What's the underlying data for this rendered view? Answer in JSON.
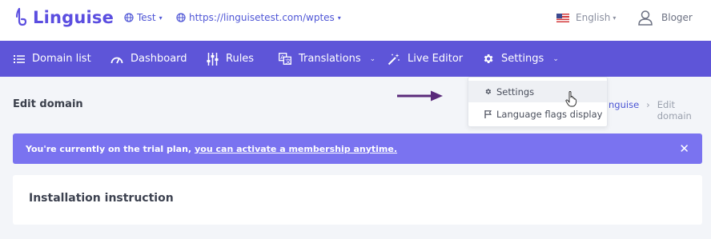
{
  "header": {
    "logo_text": "Linguise",
    "project": "Test",
    "domain_url": "https://linguisetest.com/wptes",
    "language": "English",
    "user": "Bloger"
  },
  "nav": {
    "items": [
      {
        "label": "Domain list",
        "icon": "list-icon"
      },
      {
        "label": "Dashboard",
        "icon": "gauge-icon"
      },
      {
        "label": "Rules",
        "icon": "sliders-icon"
      },
      {
        "label": "Translations",
        "icon": "translate-icon",
        "has_caret": true
      },
      {
        "label": "Live Editor",
        "icon": "magic-wand-icon"
      },
      {
        "label": "Settings",
        "icon": "gear-icon",
        "has_caret": true
      }
    ]
  },
  "page": {
    "title": "Edit domain",
    "breadcrumb": [
      "Linguise",
      "Edit domain"
    ],
    "breadcrumb_visible": [
      "nguise",
      "Edit domain"
    ]
  },
  "alert": {
    "text": "You're currently on the trial plan,",
    "link": "you can activate a membership anytime.",
    "close": "✕"
  },
  "card": {
    "title": "Installation instruction"
  },
  "dropdown": {
    "items": [
      {
        "label": "Settings",
        "icon": "gear-icon",
        "active": true
      },
      {
        "label": "Language flags display",
        "icon": "flag-icon",
        "active": false
      }
    ]
  },
  "colors": {
    "brand": "#5e55d8",
    "alert_bg": "#7a73f0",
    "page_bg": "#f3f5f9",
    "link": "#4b55d4",
    "arrow": "#5a2a7a"
  }
}
